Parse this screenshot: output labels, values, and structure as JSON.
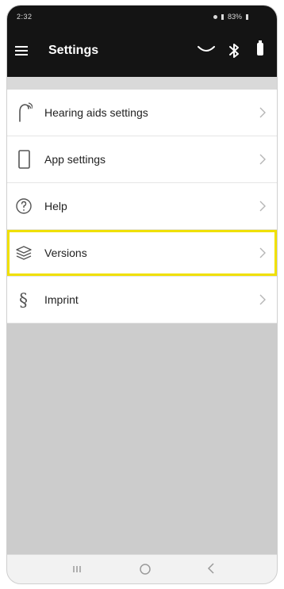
{
  "status_bar": {
    "time": "2:32",
    "battery_percent": "83%"
  },
  "app_bar": {
    "title": "Settings"
  },
  "settings_items": [
    {
      "label": "Hearing aids settings",
      "icon": "hearing-aid-icon"
    },
    {
      "label": "App settings",
      "icon": "phone-icon"
    },
    {
      "label": "Help",
      "icon": "help-icon"
    },
    {
      "label": "Versions",
      "icon": "layers-icon",
      "highlighted": true
    },
    {
      "label": "Imprint",
      "icon": "section-sign-icon"
    }
  ],
  "colors": {
    "app_bar_background": "#141414",
    "highlight_border": "#f0e000",
    "empty_area": "#cccccc"
  },
  "icons": {
    "menu": "menu-icon",
    "hearing": "hearing-icon",
    "bluetooth": "bluetooth-icon",
    "battery": "battery-icon",
    "chevron": "chevron-right-icon",
    "nav_recents": "recents-icon",
    "nav_home": "home-icon",
    "nav_back": "back-icon"
  }
}
